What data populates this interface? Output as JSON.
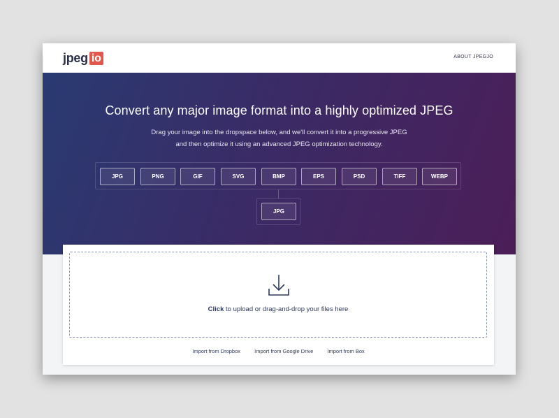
{
  "header": {
    "logo_text": "jpeg",
    "logo_badge": "io",
    "about_link": "ABOUT JPEGJO"
  },
  "hero": {
    "title": "Convert any major image format into a highly optimized JPEG",
    "subtitle_line1": "Drag your image into the dropspace below, and we'll convert it into a progressive JPEG",
    "subtitle_line2": "and then optimize it using an advanced JPEG optimization technology."
  },
  "formats": [
    "JPG",
    "PNG",
    "GIF",
    "SVG",
    "BMP",
    "EPS",
    "PSD",
    "TIFF",
    "WEBP"
  ],
  "output_format": "JPG",
  "dropzone": {
    "click_label": "Click",
    "rest_label": " to upload or drag-and-drop your files here",
    "icon": "download-icon"
  },
  "imports": [
    "Import from Dropbox",
    "Import from Google Drive",
    "Import from Box"
  ],
  "colors": {
    "hero_start": "#2a3a72",
    "hero_end": "#4c1e58",
    "logo_badge": "#e2574c"
  }
}
